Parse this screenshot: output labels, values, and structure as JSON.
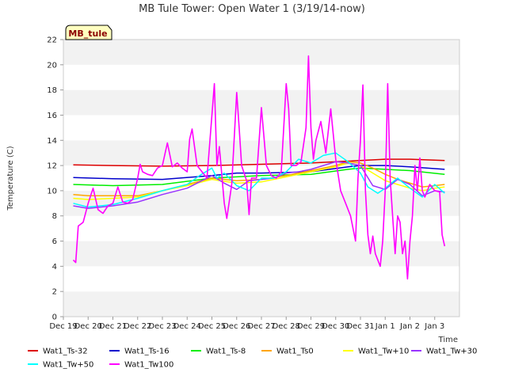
{
  "chart_data": {
    "type": "line",
    "title": "MB Tule Tower: Open Water 1 (3/19/14-now)",
    "xlabel": "Time",
    "ylabel": "Temperature (C)",
    "ylim": [
      0,
      22
    ],
    "xlim": [
      0,
      16
    ],
    "yticks": [
      0,
      2,
      4,
      6,
      8,
      10,
      12,
      14,
      16,
      18,
      20,
      22
    ],
    "x_tick_labels": [
      "Dec 19",
      "Dec 20",
      "Dec 21",
      "Dec 22",
      "Dec 23",
      "Dec 24",
      "Dec 25",
      "Dec 26",
      "Dec 27",
      "Dec 28",
      "Dec 29",
      "Dec 30",
      "Dec 31",
      "Jan 1",
      "Jan 2",
      "Jan 3"
    ],
    "grid": "horizontal bands",
    "legend_position": "bottom",
    "station_badge": "MB_tule",
    "series": [
      {
        "name": "Wat1_Ts-32",
        "color": "#dd0000",
        "x": [
          0.4,
          2,
          4,
          6,
          8,
          10,
          12,
          13,
          14,
          15.4
        ],
        "y": [
          12.05,
          12.0,
          11.95,
          12.0,
          12.1,
          12.2,
          12.4,
          12.5,
          12.5,
          12.4
        ]
      },
      {
        "name": "Wat1_Ts-16",
        "color": "#0000cc",
        "x": [
          0.4,
          2,
          4,
          6,
          7,
          8,
          10,
          11.5,
          12,
          13,
          14,
          15.4
        ],
        "y": [
          11.05,
          10.95,
          10.9,
          11.2,
          11.4,
          11.4,
          11.5,
          11.9,
          12.0,
          12.0,
          11.9,
          11.7
        ]
      },
      {
        "name": "Wat1_Ts-8",
        "color": "#00ee00",
        "x": [
          0.4,
          2,
          4,
          6,
          8,
          10,
          11.5,
          12,
          13,
          14,
          15.4
        ],
        "y": [
          10.5,
          10.4,
          10.5,
          11.0,
          11.2,
          11.3,
          11.7,
          11.8,
          11.7,
          11.6,
          11.3
        ]
      },
      {
        "name": "Wat1_Ts0",
        "color": "#ffa500",
        "x": [
          0.4,
          1,
          2,
          3,
          4,
          5,
          6,
          7,
          8,
          9,
          10,
          11,
          11.5,
          12,
          12.5,
          13,
          13.5,
          14,
          14.5,
          15,
          15.4
        ],
        "y": [
          9.7,
          9.6,
          9.6,
          9.6,
          10.0,
          10.5,
          11.0,
          10.8,
          10.9,
          11.2,
          11.6,
          12.0,
          12.3,
          12.2,
          11.8,
          11.3,
          10.9,
          10.6,
          10.3,
          10.4,
          10.5
        ]
      },
      {
        "name": "Wat1_Tw+10",
        "color": "#ffff00",
        "x": [
          0.4,
          1,
          2,
          3,
          4,
          5,
          6,
          7,
          8,
          9,
          10,
          11,
          11.5,
          12,
          12.5,
          13,
          13.5,
          14,
          14.5,
          15,
          15.4
        ],
        "y": [
          9.4,
          9.3,
          9.4,
          9.5,
          10.0,
          10.4,
          10.9,
          10.6,
          10.7,
          11.1,
          11.5,
          11.9,
          12.2,
          12.0,
          11.4,
          10.8,
          10.5,
          10.2,
          10.0,
          10.2,
          10.3
        ]
      },
      {
        "name": "Wat1_Tw+30",
        "color": "#9933ff",
        "x": [
          0.4,
          1,
          2,
          3,
          4,
          5,
          6,
          6.5,
          7,
          7.5,
          8,
          8.5,
          9,
          9.5,
          10,
          10.5,
          11,
          11.5,
          12,
          12.5,
          13,
          13.5,
          14,
          14.5,
          15,
          15.4
        ],
        "y": [
          8.8,
          8.6,
          8.8,
          9.1,
          9.7,
          10.2,
          11.2,
          10.6,
          10.1,
          10.8,
          10.9,
          11.0,
          11.4,
          11.5,
          11.7,
          12.0,
          12.3,
          12.2,
          12.0,
          10.4,
          10.1,
          10.9,
          10.5,
          9.6,
          10.0,
          9.9
        ]
      },
      {
        "name": "Wat1_Tw+50",
        "color": "#00ffff",
        "x": [
          0.4,
          1,
          2,
          3,
          4,
          5,
          5.5,
          6,
          6.2,
          6.5,
          7,
          7.5,
          8,
          8.5,
          9,
          9.5,
          10,
          10.5,
          11,
          11.5,
          12,
          12.3,
          12.7,
          13,
          13.5,
          14,
          14.5,
          15,
          15.4
        ],
        "y": [
          9.0,
          8.7,
          8.9,
          9.4,
          10.0,
          10.5,
          11.2,
          11.8,
          11.0,
          11.4,
          10.4,
          10.0,
          11.0,
          11.0,
          11.5,
          12.5,
          12.2,
          12.8,
          13.0,
          12.3,
          11.4,
          10.3,
          9.8,
          10.2,
          11.0,
          10.2,
          9.5,
          10.5,
          9.8
        ]
      },
      {
        "name": "Wat1_Tw100",
        "color": "#ff00ff",
        "x": [
          0.4,
          0.5,
          0.6,
          0.8,
          1.0,
          1.2,
          1.4,
          1.6,
          1.8,
          2.0,
          2.2,
          2.4,
          2.6,
          2.8,
          3.0,
          3.1,
          3.2,
          3.4,
          3.6,
          3.8,
          4.0,
          4.2,
          4.4,
          4.6,
          4.8,
          5.0,
          5.1,
          5.2,
          5.4,
          5.6,
          5.8,
          6.0,
          6.1,
          6.2,
          6.3,
          6.5,
          6.6,
          6.8,
          7.0,
          7.1,
          7.2,
          7.4,
          7.5,
          7.6,
          7.8,
          8.0,
          8.2,
          8.4,
          8.6,
          8.8,
          9.0,
          9.1,
          9.2,
          9.4,
          9.6,
          9.8,
          9.9,
          10.0,
          10.1,
          10.2,
          10.4,
          10.6,
          10.8,
          11.0,
          11.2,
          11.4,
          11.6,
          11.8,
          11.9,
          12.0,
          12.1,
          12.2,
          12.3,
          12.4,
          12.5,
          12.6,
          12.8,
          12.9,
          13.0,
          13.1,
          13.2,
          13.3,
          13.4,
          13.5,
          13.6,
          13.7,
          13.8,
          13.9,
          14.0,
          14.1,
          14.2,
          14.3,
          14.4,
          14.5,
          14.6,
          14.8,
          15.0,
          15.2,
          15.3,
          15.4
        ],
        "y": [
          4.5,
          4.3,
          7.2,
          7.5,
          9.0,
          10.2,
          8.5,
          8.2,
          8.8,
          9.0,
          10.3,
          9.1,
          9.0,
          9.3,
          11.0,
          12.1,
          11.5,
          11.3,
          11.2,
          11.8,
          12.0,
          13.8,
          11.9,
          12.2,
          11.8,
          11.5,
          14.1,
          14.9,
          12.0,
          11.5,
          11.0,
          16.0,
          18.5,
          12.0,
          13.5,
          9.0,
          7.8,
          10.5,
          17.8,
          15.0,
          12.0,
          10.8,
          8.1,
          11.0,
          11.0,
          16.6,
          12.0,
          11.2,
          11.0,
          11.5,
          18.5,
          16.5,
          12.0,
          12.0,
          12.3,
          15.0,
          20.7,
          15.0,
          12.5,
          14.0,
          15.5,
          13.0,
          16.5,
          12.5,
          10.0,
          9.0,
          8.0,
          6.0,
          11.0,
          14.0,
          18.4,
          10.0,
          6.5,
          5.0,
          6.4,
          5.0,
          4.0,
          6.0,
          10.0,
          18.5,
          11.0,
          8.0,
          5.0,
          8.0,
          7.5,
          5.0,
          6.0,
          3.0,
          6.0,
          8.0,
          12.0,
          10.0,
          12.6,
          10.0,
          9.5,
          10.5,
          10.0,
          9.9,
          6.5,
          5.6
        ]
      }
    ]
  }
}
